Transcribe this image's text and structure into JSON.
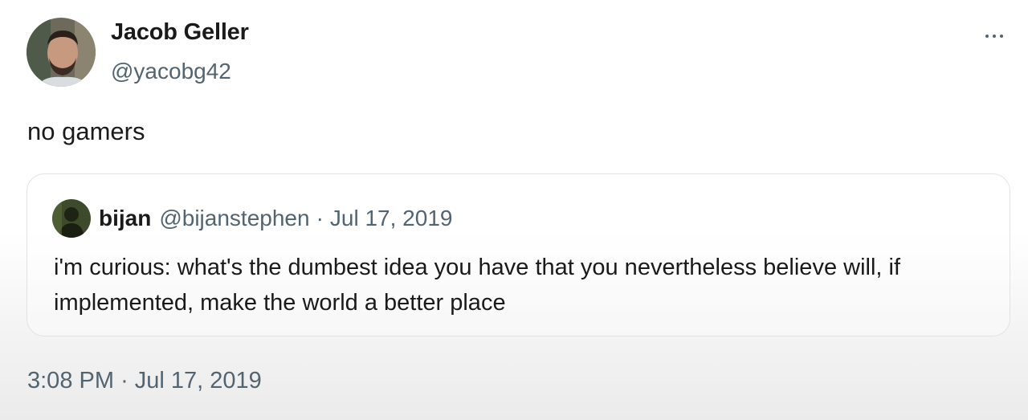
{
  "author": {
    "display_name": "Jacob Geller",
    "handle": "@yacobg42",
    "avatar_icon": "profile-photo"
  },
  "more_icon": "more-options-icon",
  "tweet": {
    "text": "no gamers",
    "time": "3:08 PM",
    "separator": "·",
    "date": "Jul 17, 2019"
  },
  "quoted_tweet": {
    "display_name": "bijan",
    "handle": "@bijanstephen",
    "separator": "·",
    "date": "Jul 17, 2019",
    "text": "i'm curious: what's the dumbest idea you have that you nevertheless believe will, if implemented, make the world a better place"
  },
  "colors": {
    "text_primary": "#0f1419",
    "text_secondary": "#536471",
    "border": "#dfe3e6"
  }
}
